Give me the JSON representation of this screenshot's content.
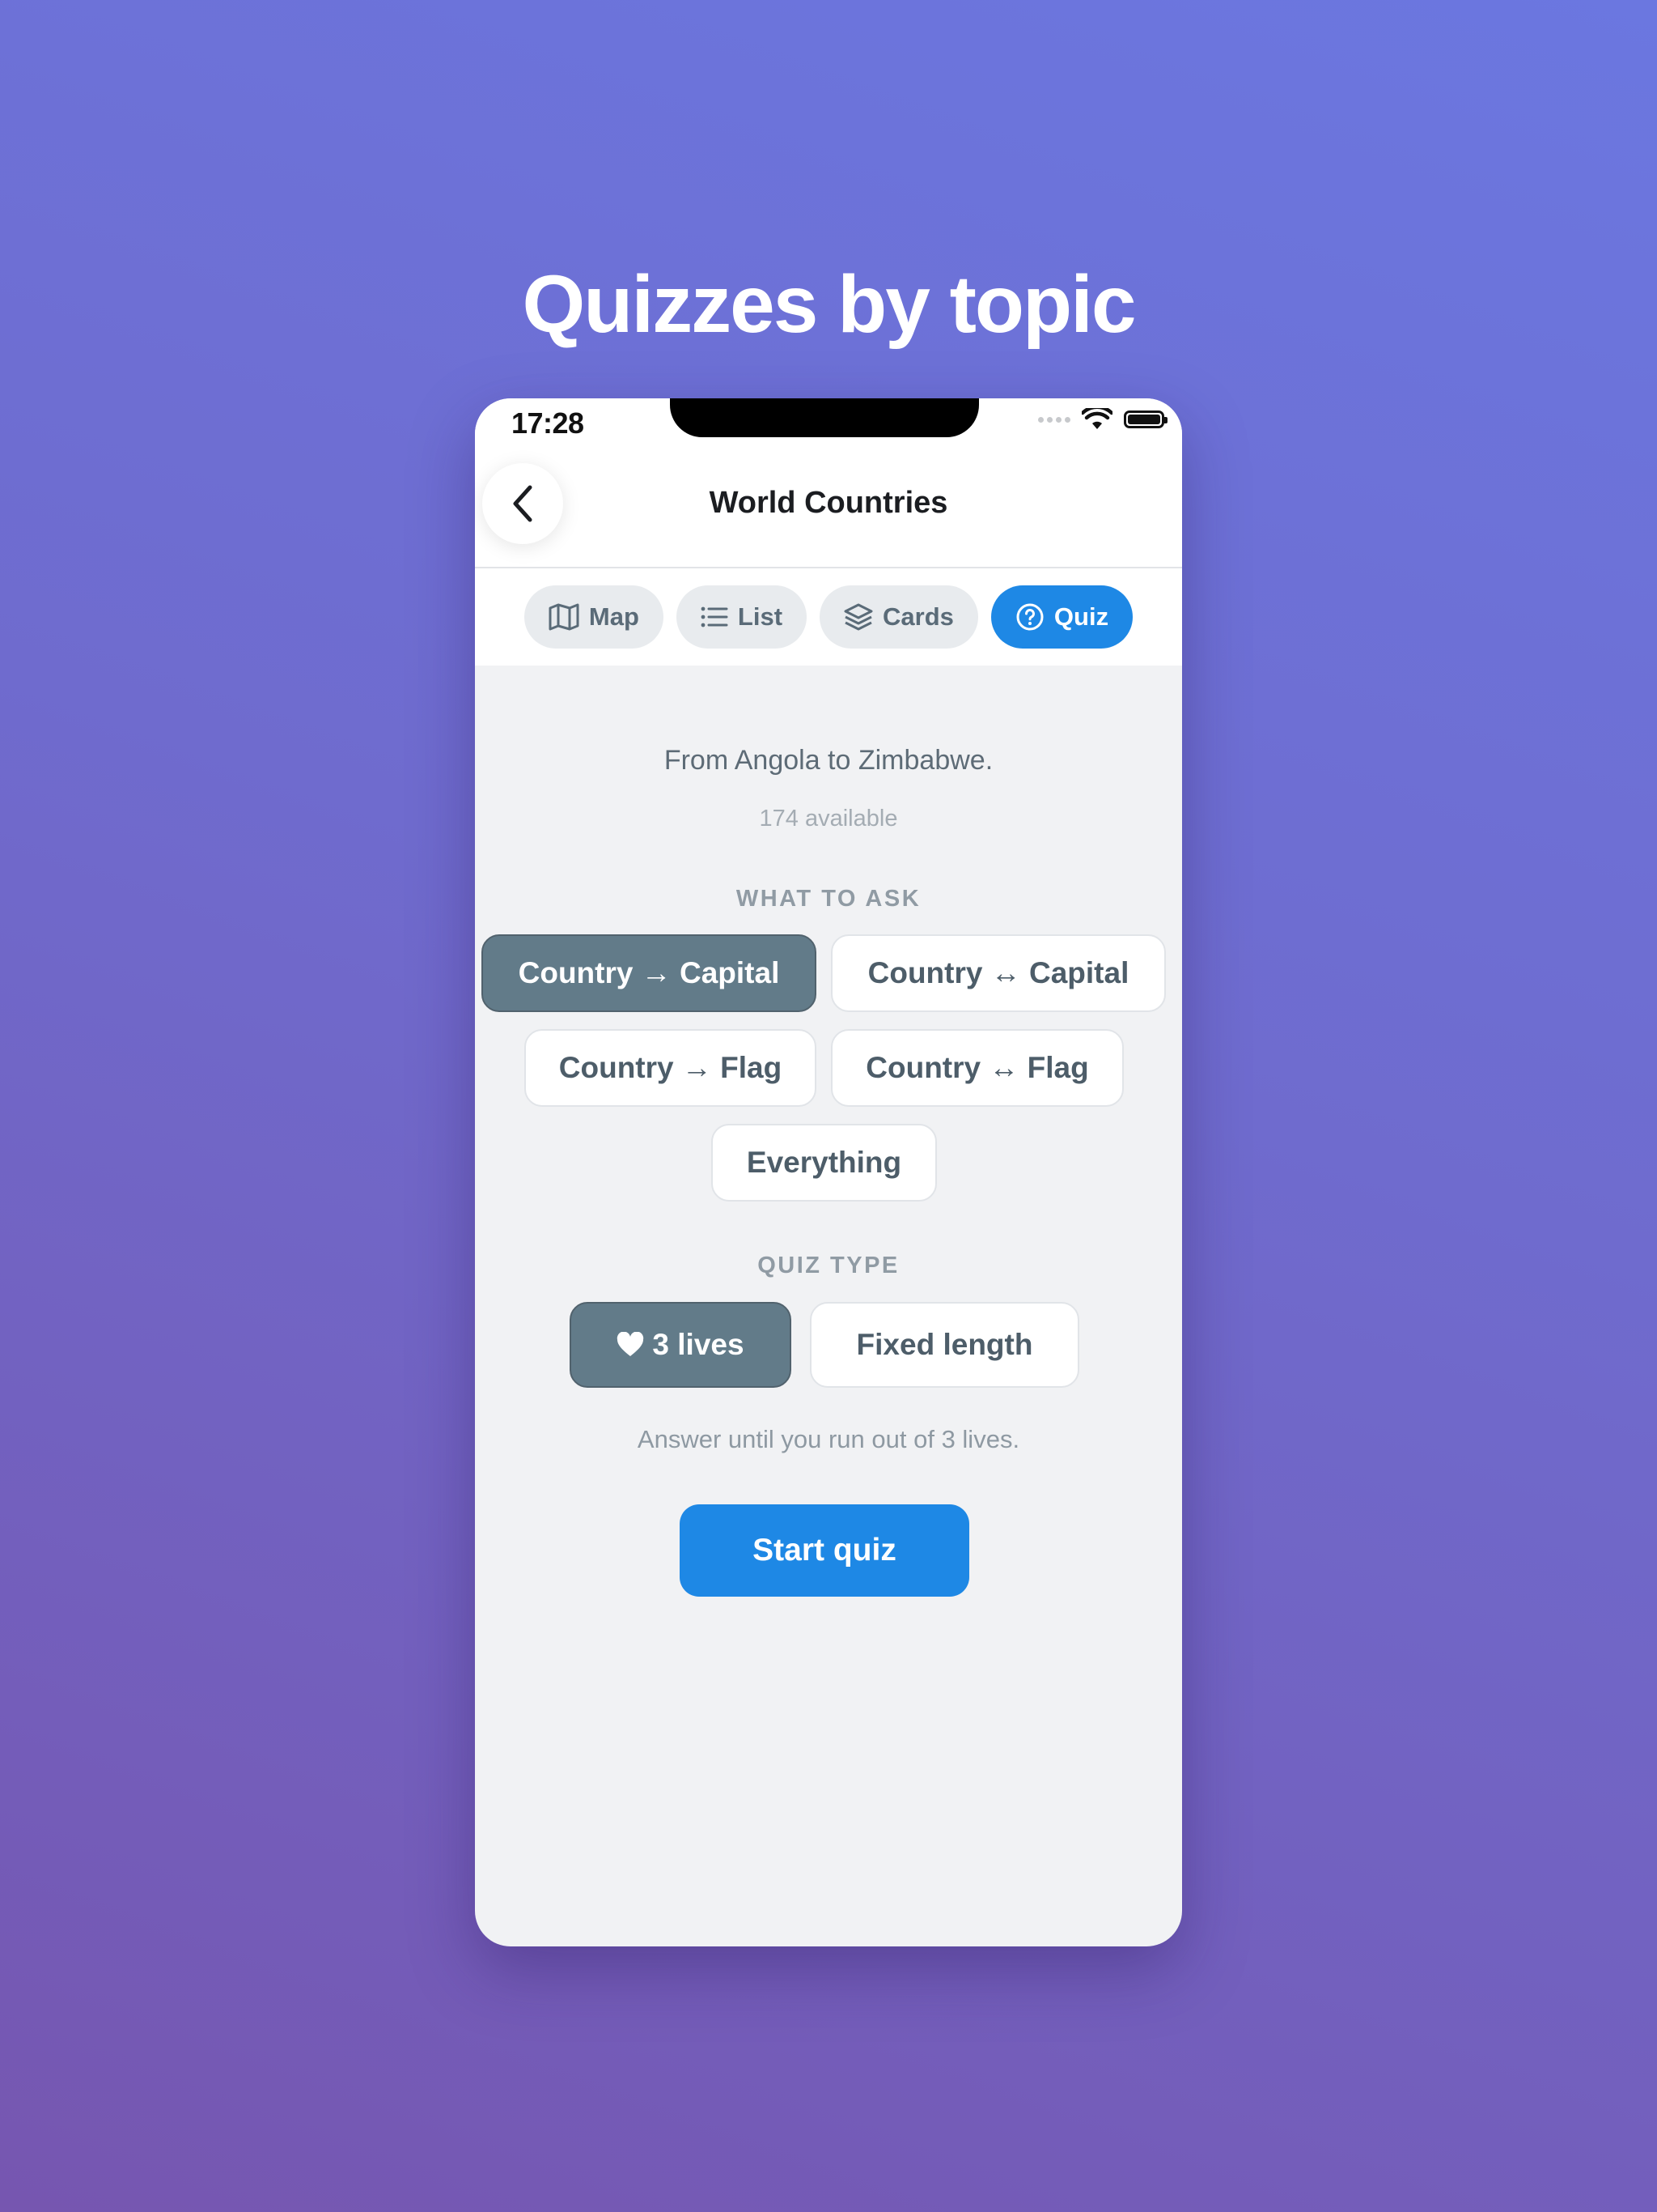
{
  "headline": "Quizzes by topic",
  "status_bar": {
    "time": "17:28"
  },
  "nav": {
    "title": "World Countries"
  },
  "tabs": [
    {
      "label": "Map",
      "icon": "map-icon"
    },
    {
      "label": "List",
      "icon": "list-icon"
    },
    {
      "label": "Cards",
      "icon": "layers-icon"
    },
    {
      "label": "Quiz",
      "icon": "question-circle-icon",
      "active": true
    }
  ],
  "intro": {
    "subtitle": "From Angola to Zimbabwe.",
    "count": "174 available"
  },
  "what_to_ask": {
    "label": "WHAT TO ASK",
    "options": [
      {
        "label": "Country → Capital",
        "selected": true
      },
      {
        "label": "Country ↔ Capital",
        "selected": false
      },
      {
        "label": "Country → Flag",
        "selected": false
      },
      {
        "label": "Country ↔ Flag",
        "selected": false
      },
      {
        "label": "Everything",
        "selected": false
      }
    ]
  },
  "quiz_type": {
    "label": "QUIZ TYPE",
    "options": [
      {
        "label": "3 lives",
        "icon": "heart-icon",
        "selected": true
      },
      {
        "label": "Fixed length",
        "selected": false
      }
    ],
    "hint": "Answer until you run out of 3 lives."
  },
  "start_button": {
    "label": "Start quiz"
  },
  "colors": {
    "accent": "#1e88e5",
    "selected_chip": "#627b89",
    "panel_bg": "#f1f2f4"
  }
}
